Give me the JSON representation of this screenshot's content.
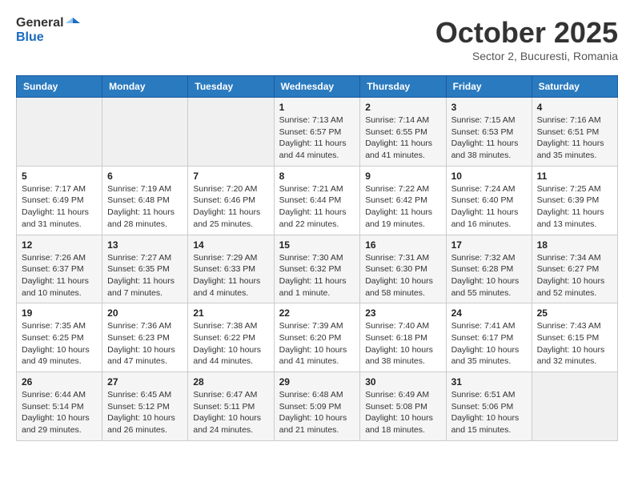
{
  "header": {
    "logo_general": "General",
    "logo_blue": "Blue",
    "month": "October 2025",
    "location": "Sector 2, Bucuresti, Romania"
  },
  "days_of_week": [
    "Sunday",
    "Monday",
    "Tuesday",
    "Wednesday",
    "Thursday",
    "Friday",
    "Saturday"
  ],
  "weeks": [
    [
      {
        "day": "",
        "info": ""
      },
      {
        "day": "",
        "info": ""
      },
      {
        "day": "",
        "info": ""
      },
      {
        "day": "1",
        "info": "Sunrise: 7:13 AM\nSunset: 6:57 PM\nDaylight: 11 hours and 44 minutes."
      },
      {
        "day": "2",
        "info": "Sunrise: 7:14 AM\nSunset: 6:55 PM\nDaylight: 11 hours and 41 minutes."
      },
      {
        "day": "3",
        "info": "Sunrise: 7:15 AM\nSunset: 6:53 PM\nDaylight: 11 hours and 38 minutes."
      },
      {
        "day": "4",
        "info": "Sunrise: 7:16 AM\nSunset: 6:51 PM\nDaylight: 11 hours and 35 minutes."
      }
    ],
    [
      {
        "day": "5",
        "info": "Sunrise: 7:17 AM\nSunset: 6:49 PM\nDaylight: 11 hours and 31 minutes."
      },
      {
        "day": "6",
        "info": "Sunrise: 7:19 AM\nSunset: 6:48 PM\nDaylight: 11 hours and 28 minutes."
      },
      {
        "day": "7",
        "info": "Sunrise: 7:20 AM\nSunset: 6:46 PM\nDaylight: 11 hours and 25 minutes."
      },
      {
        "day": "8",
        "info": "Sunrise: 7:21 AM\nSunset: 6:44 PM\nDaylight: 11 hours and 22 minutes."
      },
      {
        "day": "9",
        "info": "Sunrise: 7:22 AM\nSunset: 6:42 PM\nDaylight: 11 hours and 19 minutes."
      },
      {
        "day": "10",
        "info": "Sunrise: 7:24 AM\nSunset: 6:40 PM\nDaylight: 11 hours and 16 minutes."
      },
      {
        "day": "11",
        "info": "Sunrise: 7:25 AM\nSunset: 6:39 PM\nDaylight: 11 hours and 13 minutes."
      }
    ],
    [
      {
        "day": "12",
        "info": "Sunrise: 7:26 AM\nSunset: 6:37 PM\nDaylight: 11 hours and 10 minutes."
      },
      {
        "day": "13",
        "info": "Sunrise: 7:27 AM\nSunset: 6:35 PM\nDaylight: 11 hours and 7 minutes."
      },
      {
        "day": "14",
        "info": "Sunrise: 7:29 AM\nSunset: 6:33 PM\nDaylight: 11 hours and 4 minutes."
      },
      {
        "day": "15",
        "info": "Sunrise: 7:30 AM\nSunset: 6:32 PM\nDaylight: 11 hours and 1 minute."
      },
      {
        "day": "16",
        "info": "Sunrise: 7:31 AM\nSunset: 6:30 PM\nDaylight: 10 hours and 58 minutes."
      },
      {
        "day": "17",
        "info": "Sunrise: 7:32 AM\nSunset: 6:28 PM\nDaylight: 10 hours and 55 minutes."
      },
      {
        "day": "18",
        "info": "Sunrise: 7:34 AM\nSunset: 6:27 PM\nDaylight: 10 hours and 52 minutes."
      }
    ],
    [
      {
        "day": "19",
        "info": "Sunrise: 7:35 AM\nSunset: 6:25 PM\nDaylight: 10 hours and 49 minutes."
      },
      {
        "day": "20",
        "info": "Sunrise: 7:36 AM\nSunset: 6:23 PM\nDaylight: 10 hours and 47 minutes."
      },
      {
        "day": "21",
        "info": "Sunrise: 7:38 AM\nSunset: 6:22 PM\nDaylight: 10 hours and 44 minutes."
      },
      {
        "day": "22",
        "info": "Sunrise: 7:39 AM\nSunset: 6:20 PM\nDaylight: 10 hours and 41 minutes."
      },
      {
        "day": "23",
        "info": "Sunrise: 7:40 AM\nSunset: 6:18 PM\nDaylight: 10 hours and 38 minutes."
      },
      {
        "day": "24",
        "info": "Sunrise: 7:41 AM\nSunset: 6:17 PM\nDaylight: 10 hours and 35 minutes."
      },
      {
        "day": "25",
        "info": "Sunrise: 7:43 AM\nSunset: 6:15 PM\nDaylight: 10 hours and 32 minutes."
      }
    ],
    [
      {
        "day": "26",
        "info": "Sunrise: 6:44 AM\nSunset: 5:14 PM\nDaylight: 10 hours and 29 minutes."
      },
      {
        "day": "27",
        "info": "Sunrise: 6:45 AM\nSunset: 5:12 PM\nDaylight: 10 hours and 26 minutes."
      },
      {
        "day": "28",
        "info": "Sunrise: 6:47 AM\nSunset: 5:11 PM\nDaylight: 10 hours and 24 minutes."
      },
      {
        "day": "29",
        "info": "Sunrise: 6:48 AM\nSunset: 5:09 PM\nDaylight: 10 hours and 21 minutes."
      },
      {
        "day": "30",
        "info": "Sunrise: 6:49 AM\nSunset: 5:08 PM\nDaylight: 10 hours and 18 minutes."
      },
      {
        "day": "31",
        "info": "Sunrise: 6:51 AM\nSunset: 5:06 PM\nDaylight: 10 hours and 15 minutes."
      },
      {
        "day": "",
        "info": ""
      }
    ]
  ]
}
